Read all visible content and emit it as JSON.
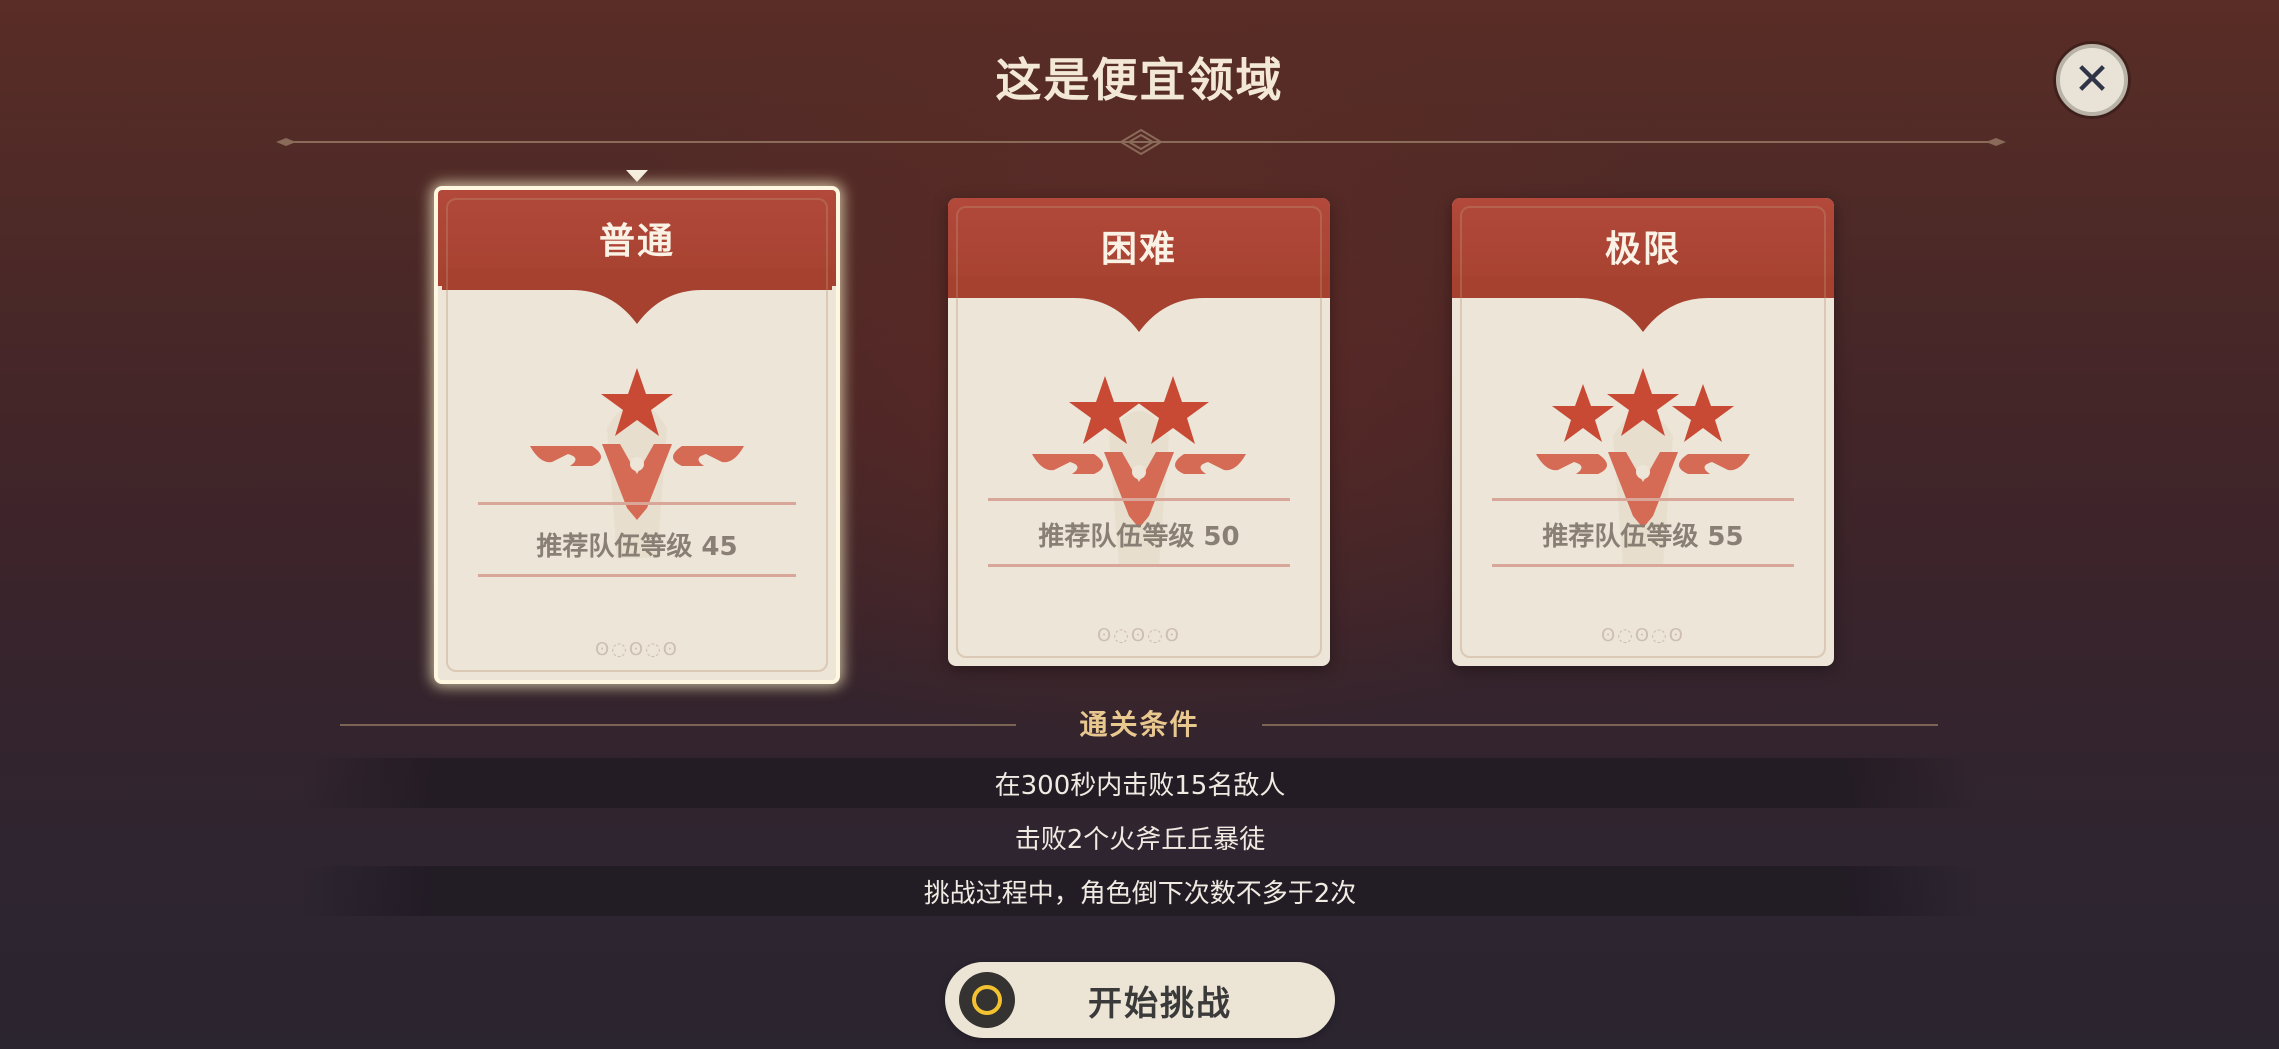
{
  "title": "这是便宜领域",
  "close_icon": "close-icon",
  "cards": [
    {
      "label": "普通",
      "stars": 1,
      "level_text": "推荐队伍等级 45",
      "selected": true
    },
    {
      "label": "困难",
      "stars": 2,
      "level_text": "推荐队伍等级 50",
      "selected": false
    },
    {
      "label": "极限",
      "stars": 3,
      "level_text": "推荐队伍等级 55",
      "selected": false
    }
  ],
  "conditions": {
    "title": "通关条件",
    "items": [
      "在300秒内击败15名敌人",
      "击败2个火斧丘丘暴徒",
      "挑战过程中，角色倒下次数不多于2次"
    ]
  },
  "start_button": {
    "label": "开始挑战",
    "icon": "controller-button-icon"
  },
  "colors": {
    "header_red": "#aa4433",
    "card_bg": "#ece5d8",
    "star_red": "#c84a35",
    "accent_gold": "#e8c88f"
  }
}
